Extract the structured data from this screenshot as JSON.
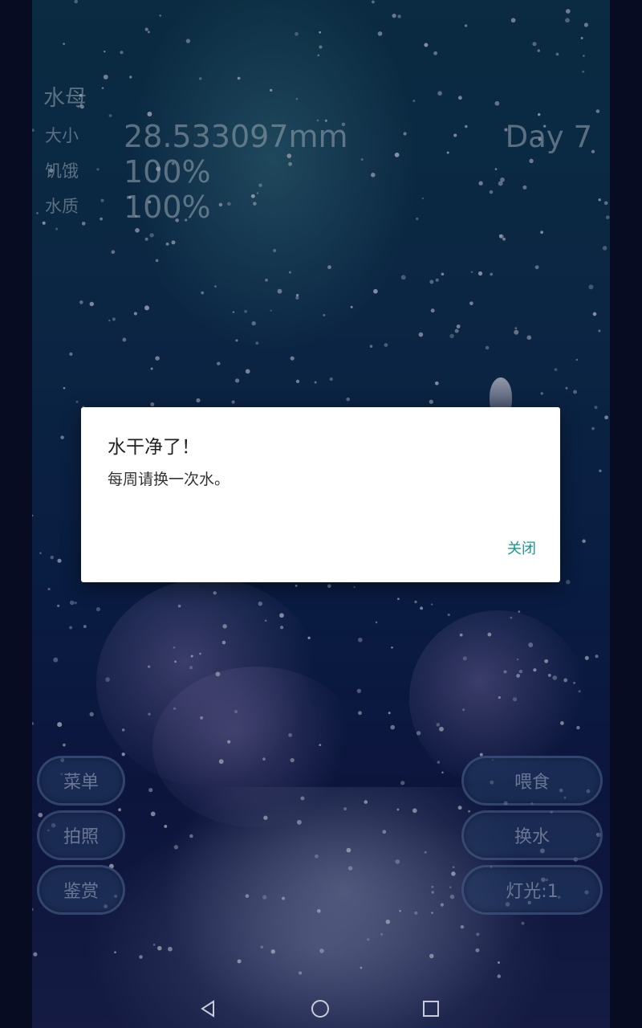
{
  "hud": {
    "title": "水母",
    "size_label": "大小",
    "size_value": "28.533097mm",
    "hunger_label": "饥饿",
    "hunger_value": "100%",
    "water_label": "水质",
    "water_value": "100%",
    "day": "Day 7"
  },
  "buttons": {
    "left": [
      "菜单",
      "拍照",
      "鉴赏"
    ],
    "right": [
      "喂食",
      "换水",
      "灯光:1"
    ]
  },
  "dialog": {
    "title": "水干净了！",
    "message": "每周请换一次水。",
    "close_label": "关闭"
  },
  "navbar": {
    "back_icon": "back-triangle-icon",
    "home_icon": "home-circle-icon",
    "recents_icon": "recents-square-icon"
  },
  "colors": {
    "accent": "#159a8c",
    "water_top": "#0d3550",
    "water_bottom": "#1a2252"
  }
}
